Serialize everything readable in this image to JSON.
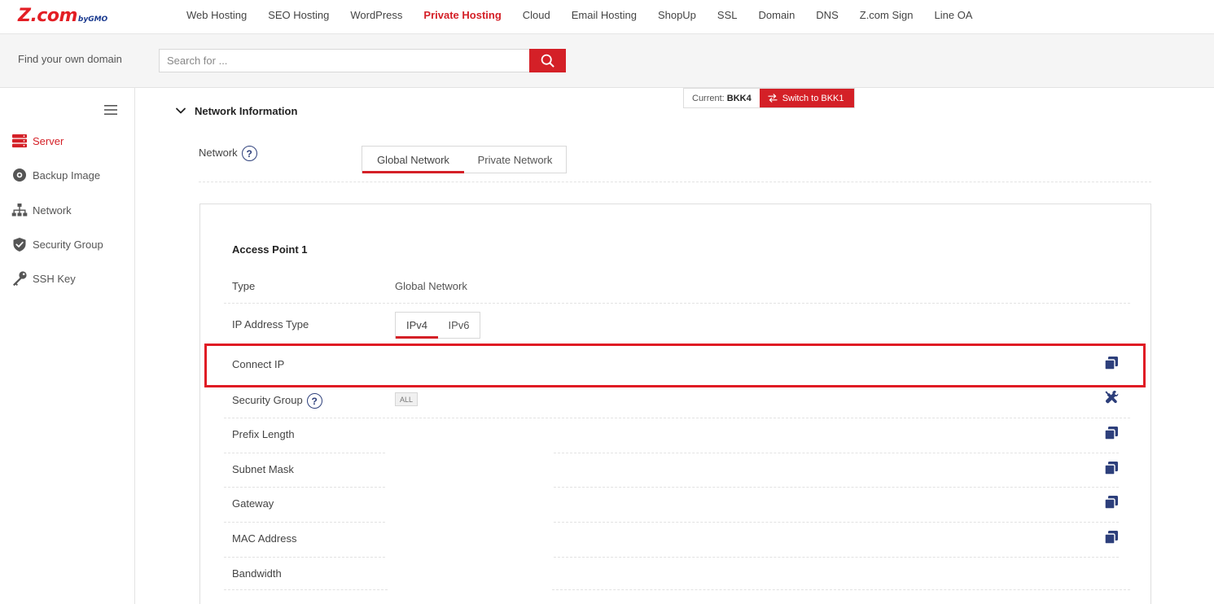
{
  "brand": {
    "logo_main": "Z.com",
    "logo_sub": "byGMO"
  },
  "nav": {
    "items": [
      {
        "label": "Web Hosting"
      },
      {
        "label": "SEO Hosting"
      },
      {
        "label": "WordPress"
      },
      {
        "label": "Private Hosting",
        "active": true
      },
      {
        "label": "Cloud"
      },
      {
        "label": "Email Hosting"
      },
      {
        "label": "ShopUp"
      },
      {
        "label": "SSL"
      },
      {
        "label": "Domain"
      },
      {
        "label": "DNS"
      },
      {
        "label": "Z.com Sign"
      },
      {
        "label": "Line OA"
      }
    ]
  },
  "search": {
    "label": "Find your own domain",
    "placeholder": "Search for ...",
    "value": ""
  },
  "sidebar": {
    "items": [
      {
        "label": "Server",
        "icon": "server-icon",
        "active": true
      },
      {
        "label": "Backup Image",
        "icon": "disc-icon"
      },
      {
        "label": "Network",
        "icon": "network-icon"
      },
      {
        "label": "Security Group",
        "icon": "shield-icon"
      },
      {
        "label": "SSH Key",
        "icon": "key-icon"
      }
    ]
  },
  "region": {
    "current_label": "Current:",
    "current_value": "BKK4",
    "switch_label": "Switch to BKK1"
  },
  "section": {
    "title": "Network Information",
    "network_label": "Network",
    "tabs": [
      {
        "label": "Global Network",
        "active": true
      },
      {
        "label": "Private Network"
      }
    ]
  },
  "access_point": {
    "title": "Access Point 1",
    "rows": {
      "type_label": "Type",
      "type_value": "Global Network",
      "ip_type_label": "IP Address Type",
      "ip_tabs": [
        {
          "label": "IPv4",
          "active": true
        },
        {
          "label": "IPv6"
        }
      ],
      "connect_ip_label": "Connect IP",
      "security_group_label": "Security Group",
      "security_group_badge": "ALL",
      "prefix_label": "Prefix Length",
      "subnet_label": "Subnet Mask",
      "gateway_label": "Gateway",
      "mac_label": "MAC Address",
      "bandwidth_label": "Bandwidth"
    }
  },
  "colors": {
    "accent": "#d42027",
    "icon_navy": "#2d3f7b",
    "highlight": "#e01b24"
  }
}
